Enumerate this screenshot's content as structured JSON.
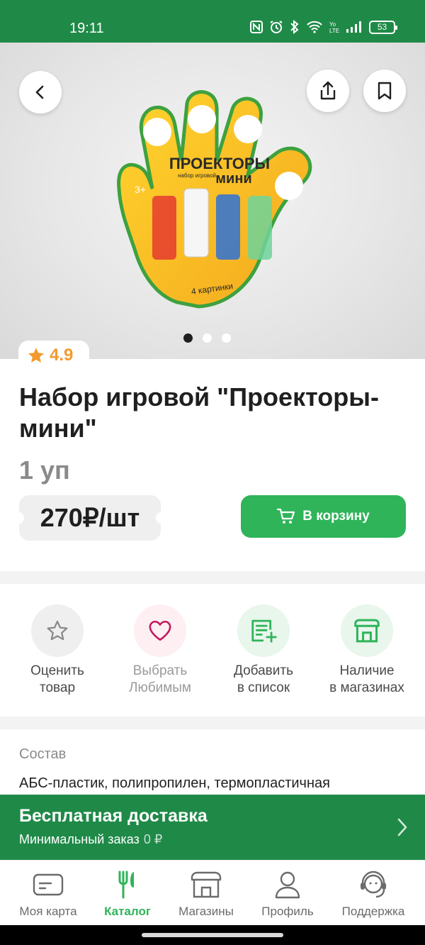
{
  "status_bar": {
    "time": "19:11",
    "battery": "53"
  },
  "hero": {
    "slides": 3,
    "active_slide": 0
  },
  "icons": {
    "back": "chevron-left-icon",
    "share": "share-icon",
    "bookmark": "bookmark-icon",
    "star": "star-icon",
    "cart": "cart-icon",
    "chevron": "chevron-right-icon"
  },
  "product": {
    "rating": "4.9",
    "title": "Набор игровой \"Проекторы-мини\"",
    "unit": "1 уп",
    "price": "270₽/шт",
    "cart_button": "В корзину",
    "image_text": {
      "line1": "ПРОЕКТОРЫ",
      "line2": "мини",
      "small": "набор игровой",
      "age": "3+",
      "caption": "4 картинки"
    }
  },
  "actions": [
    {
      "label": "Оценить\nтовар",
      "icon": "star-outline-icon"
    },
    {
      "label": "Выбрать\nЛюбимым",
      "icon": "heart-icon"
    },
    {
      "label": "Добавить\nв список",
      "icon": "add-to-list-icon"
    },
    {
      "label": "Наличие\nв магазинах",
      "icon": "store-icon"
    }
  ],
  "composition": {
    "label": "Состав",
    "text": "АБС-пластик, полипропилен, термопластичная"
  },
  "delivery": {
    "title": "Бесплатная доставка",
    "subtitle": "Минимальный заказ",
    "min_value": "0 ₽"
  },
  "nav": [
    {
      "label": "Моя карта",
      "icon": "card-icon"
    },
    {
      "label": "Каталог",
      "icon": "cutlery-icon",
      "active": true
    },
    {
      "label": "Магазины",
      "icon": "store-icon"
    },
    {
      "label": "Профиль",
      "icon": "user-icon"
    },
    {
      "label": "Поддержка",
      "icon": "support-icon"
    }
  ],
  "colors": {
    "brand_green": "#1f8a48",
    "button_green": "#2fb45a",
    "rating_orange": "#f29a2e"
  }
}
